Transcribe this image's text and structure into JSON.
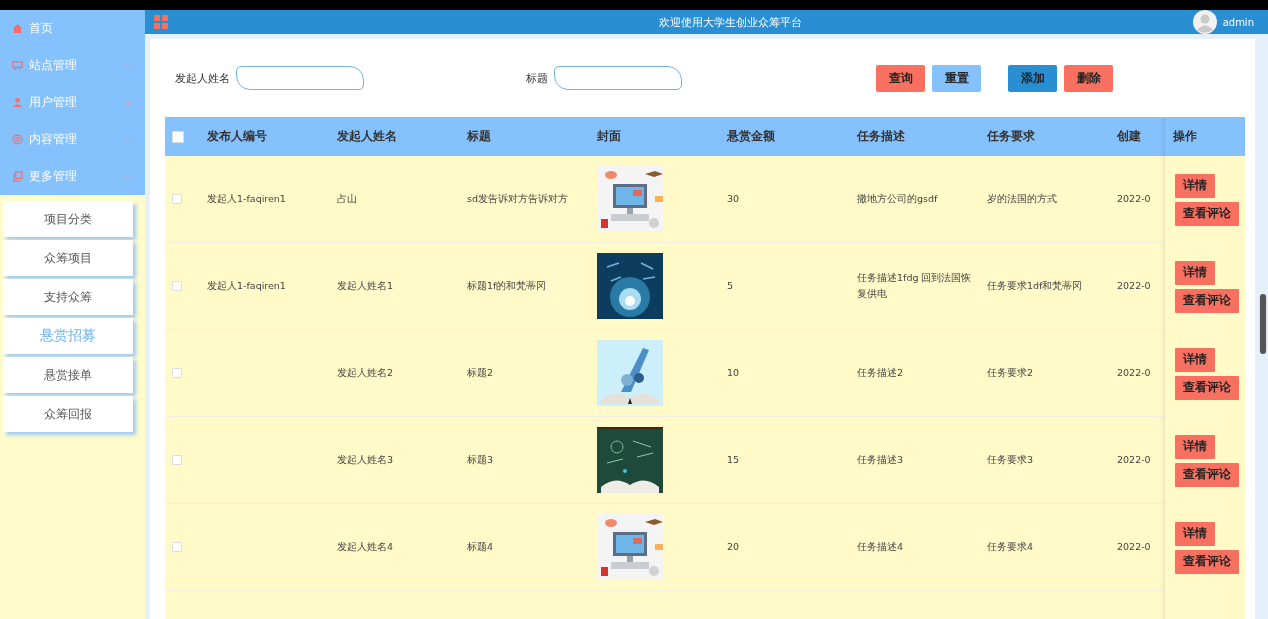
{
  "header": {
    "title": "欢迎使用大学生创业众筹平台",
    "user": "admin"
  },
  "sidebar": {
    "items": [
      {
        "label": "首页",
        "kind": "link"
      },
      {
        "label": "站点管理",
        "kind": "menu",
        "expanded": false
      },
      {
        "label": "用户管理",
        "kind": "menu",
        "expanded": false
      },
      {
        "label": "内容管理",
        "kind": "menu",
        "expanded": false
      },
      {
        "label": "更多管理",
        "kind": "menu",
        "expanded": true
      }
    ],
    "submenu": [
      {
        "label": "项目分类",
        "selected": false
      },
      {
        "label": "众筹项目",
        "selected": false
      },
      {
        "label": "支持众筹",
        "selected": false
      },
      {
        "label": "悬赏招募",
        "selected": true
      },
      {
        "label": "悬赏接单",
        "selected": false
      },
      {
        "label": "众筹回报",
        "selected": false
      }
    ]
  },
  "search": {
    "fields": [
      {
        "label": "发起人姓名"
      },
      {
        "label": "标题"
      }
    ],
    "buttons": [
      {
        "label": "查询",
        "kind": "primary"
      },
      {
        "label": "重置",
        "kind": "secondary"
      },
      {
        "label": "添加",
        "kind": "add"
      },
      {
        "label": "删除",
        "kind": "danger"
      }
    ]
  },
  "table": {
    "header_checked": false,
    "columns": [
      "发布人编号",
      "发起人姓名",
      "标题",
      "封面",
      "悬赏金额",
      "任务描述",
      "任务要求",
      "创建"
    ],
    "actions_column": "操作",
    "rows": [
      {
        "checked": false,
        "cells": [
          "发起人1-faqiren1",
          "占山",
          "sd发告诉对方告诉对方",
          {
            "kind": "picture"
          },
          "30",
          "撒地方公司的gsdf",
          "岁的法国的方式",
          "2022-0"
        ],
        "actions": [
          "详情",
          "查看评论"
        ]
      },
      {
        "checked": false,
        "cells": [
          "发起人1-faqiren1",
          "发起人姓名1",
          "标题1f的和梵蒂冈",
          {
            "kind": "picture"
          },
          "5",
          "任务描述1fdg 回到法国恢复供电",
          "任务要求1df和梵蒂冈",
          "2022-0"
        ],
        "actions": [
          "详情",
          "查看评论"
        ]
      },
      {
        "checked": false,
        "cells": [
          "",
          "发起人姓名2",
          "标题2",
          {
            "kind": "picture"
          },
          "10",
          "任务描述2",
          "任务要求2",
          "2022-0"
        ],
        "actions": [
          "详情",
          "查看评论"
        ]
      },
      {
        "checked": false,
        "cells": [
          "",
          "发起人姓名3",
          "标题3",
          {
            "kind": "picture"
          },
          "15",
          "任务描述3",
          "任务要求3",
          "2022-0"
        ],
        "actions": [
          "详情",
          "查看评论"
        ]
      },
      {
        "checked": false,
        "cells": [
          "",
          "发起人姓名4",
          "标题4",
          {
            "kind": "picture"
          },
          "20",
          "任务描述4",
          "任务要求4",
          "2022-0"
        ],
        "actions": [
          "详情",
          "查看评论"
        ]
      }
    ]
  }
}
